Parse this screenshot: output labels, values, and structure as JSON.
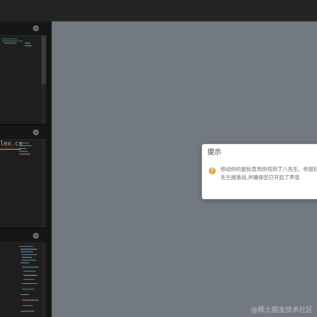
{
  "panels": [
    {
      "settings_icon": "gear-icon"
    },
    {
      "settings_icon": "gear-icon",
      "tab_label": "lex.cs"
    },
    {
      "settings_icon": "gear-icon"
    }
  ],
  "dialog": {
    "title": "提示",
    "icon": "warning-icon",
    "icon_color": "#e6a23c",
    "message_line1": "移动你的鼠标直到你找到了八先生。你鼠标",
    "message_line2": "先生越激动,并确保您已开启了声音"
  },
  "watermark": "@稀土掘金技术社区",
  "colors": {
    "preview_bg": "#737980",
    "editor_bg": "#1e1e1e",
    "tab_accent": "#e5b07a"
  }
}
